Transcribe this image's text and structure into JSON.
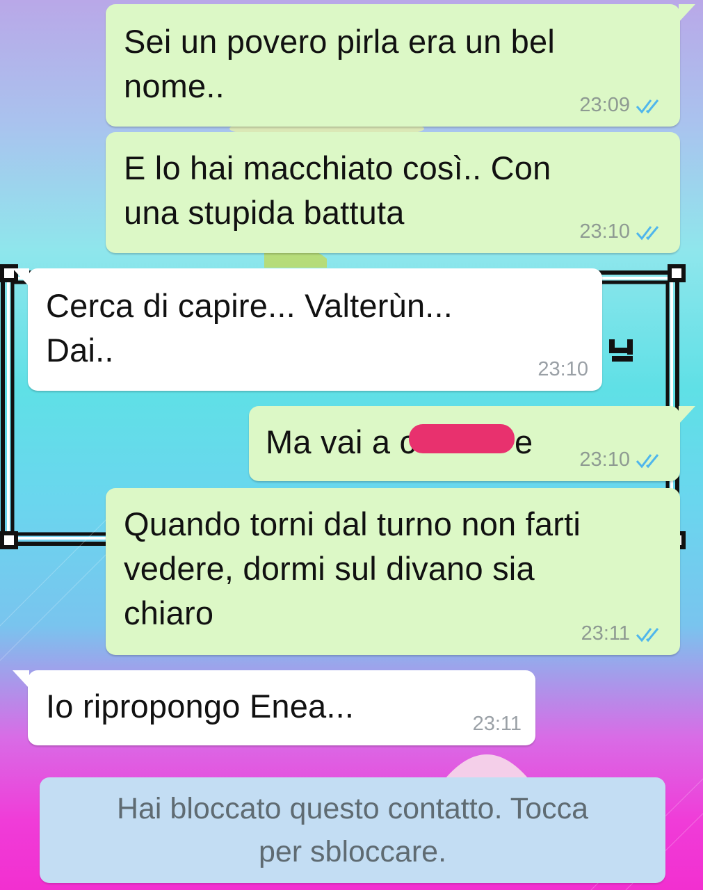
{
  "messages": [
    {
      "direction": "out",
      "text": "Sei un povero pirla era un bel\nnome..",
      "time": "23:09",
      "status": "read"
    },
    {
      "direction": "out",
      "text": "E lo hai macchiato così.. Con\nuna stupida battuta",
      "time": "23:10",
      "status": "read"
    },
    {
      "direction": "in",
      "text": "Cerca di capire... Valterùn...\nDai..",
      "time": "23:10"
    },
    {
      "direction": "out",
      "text": "Ma vai a c",
      "text_after": "e",
      "time": "23:10",
      "status": "read",
      "censored": true
    },
    {
      "direction": "out",
      "text": "Quando torni dal turno non farti\nvedere, dormi sul divano sia\nchiaro",
      "time": "23:11",
      "status": "read"
    },
    {
      "direction": "in",
      "text": "Io ripropongo Enea...",
      "time": "23:11"
    }
  ],
  "system_notice": "Hai bloccato questo contatto. Tocca\nper sbloccare.",
  "colors": {
    "outgoing_bubble": "#dcf8c6",
    "incoming_bubble": "#ffffff",
    "read_ticks": "#4fb6ec",
    "censor_mark": "#e8316e",
    "system_notice_bg": "#c3ddf3"
  },
  "icons": {
    "read_status": "double-check-icon"
  }
}
